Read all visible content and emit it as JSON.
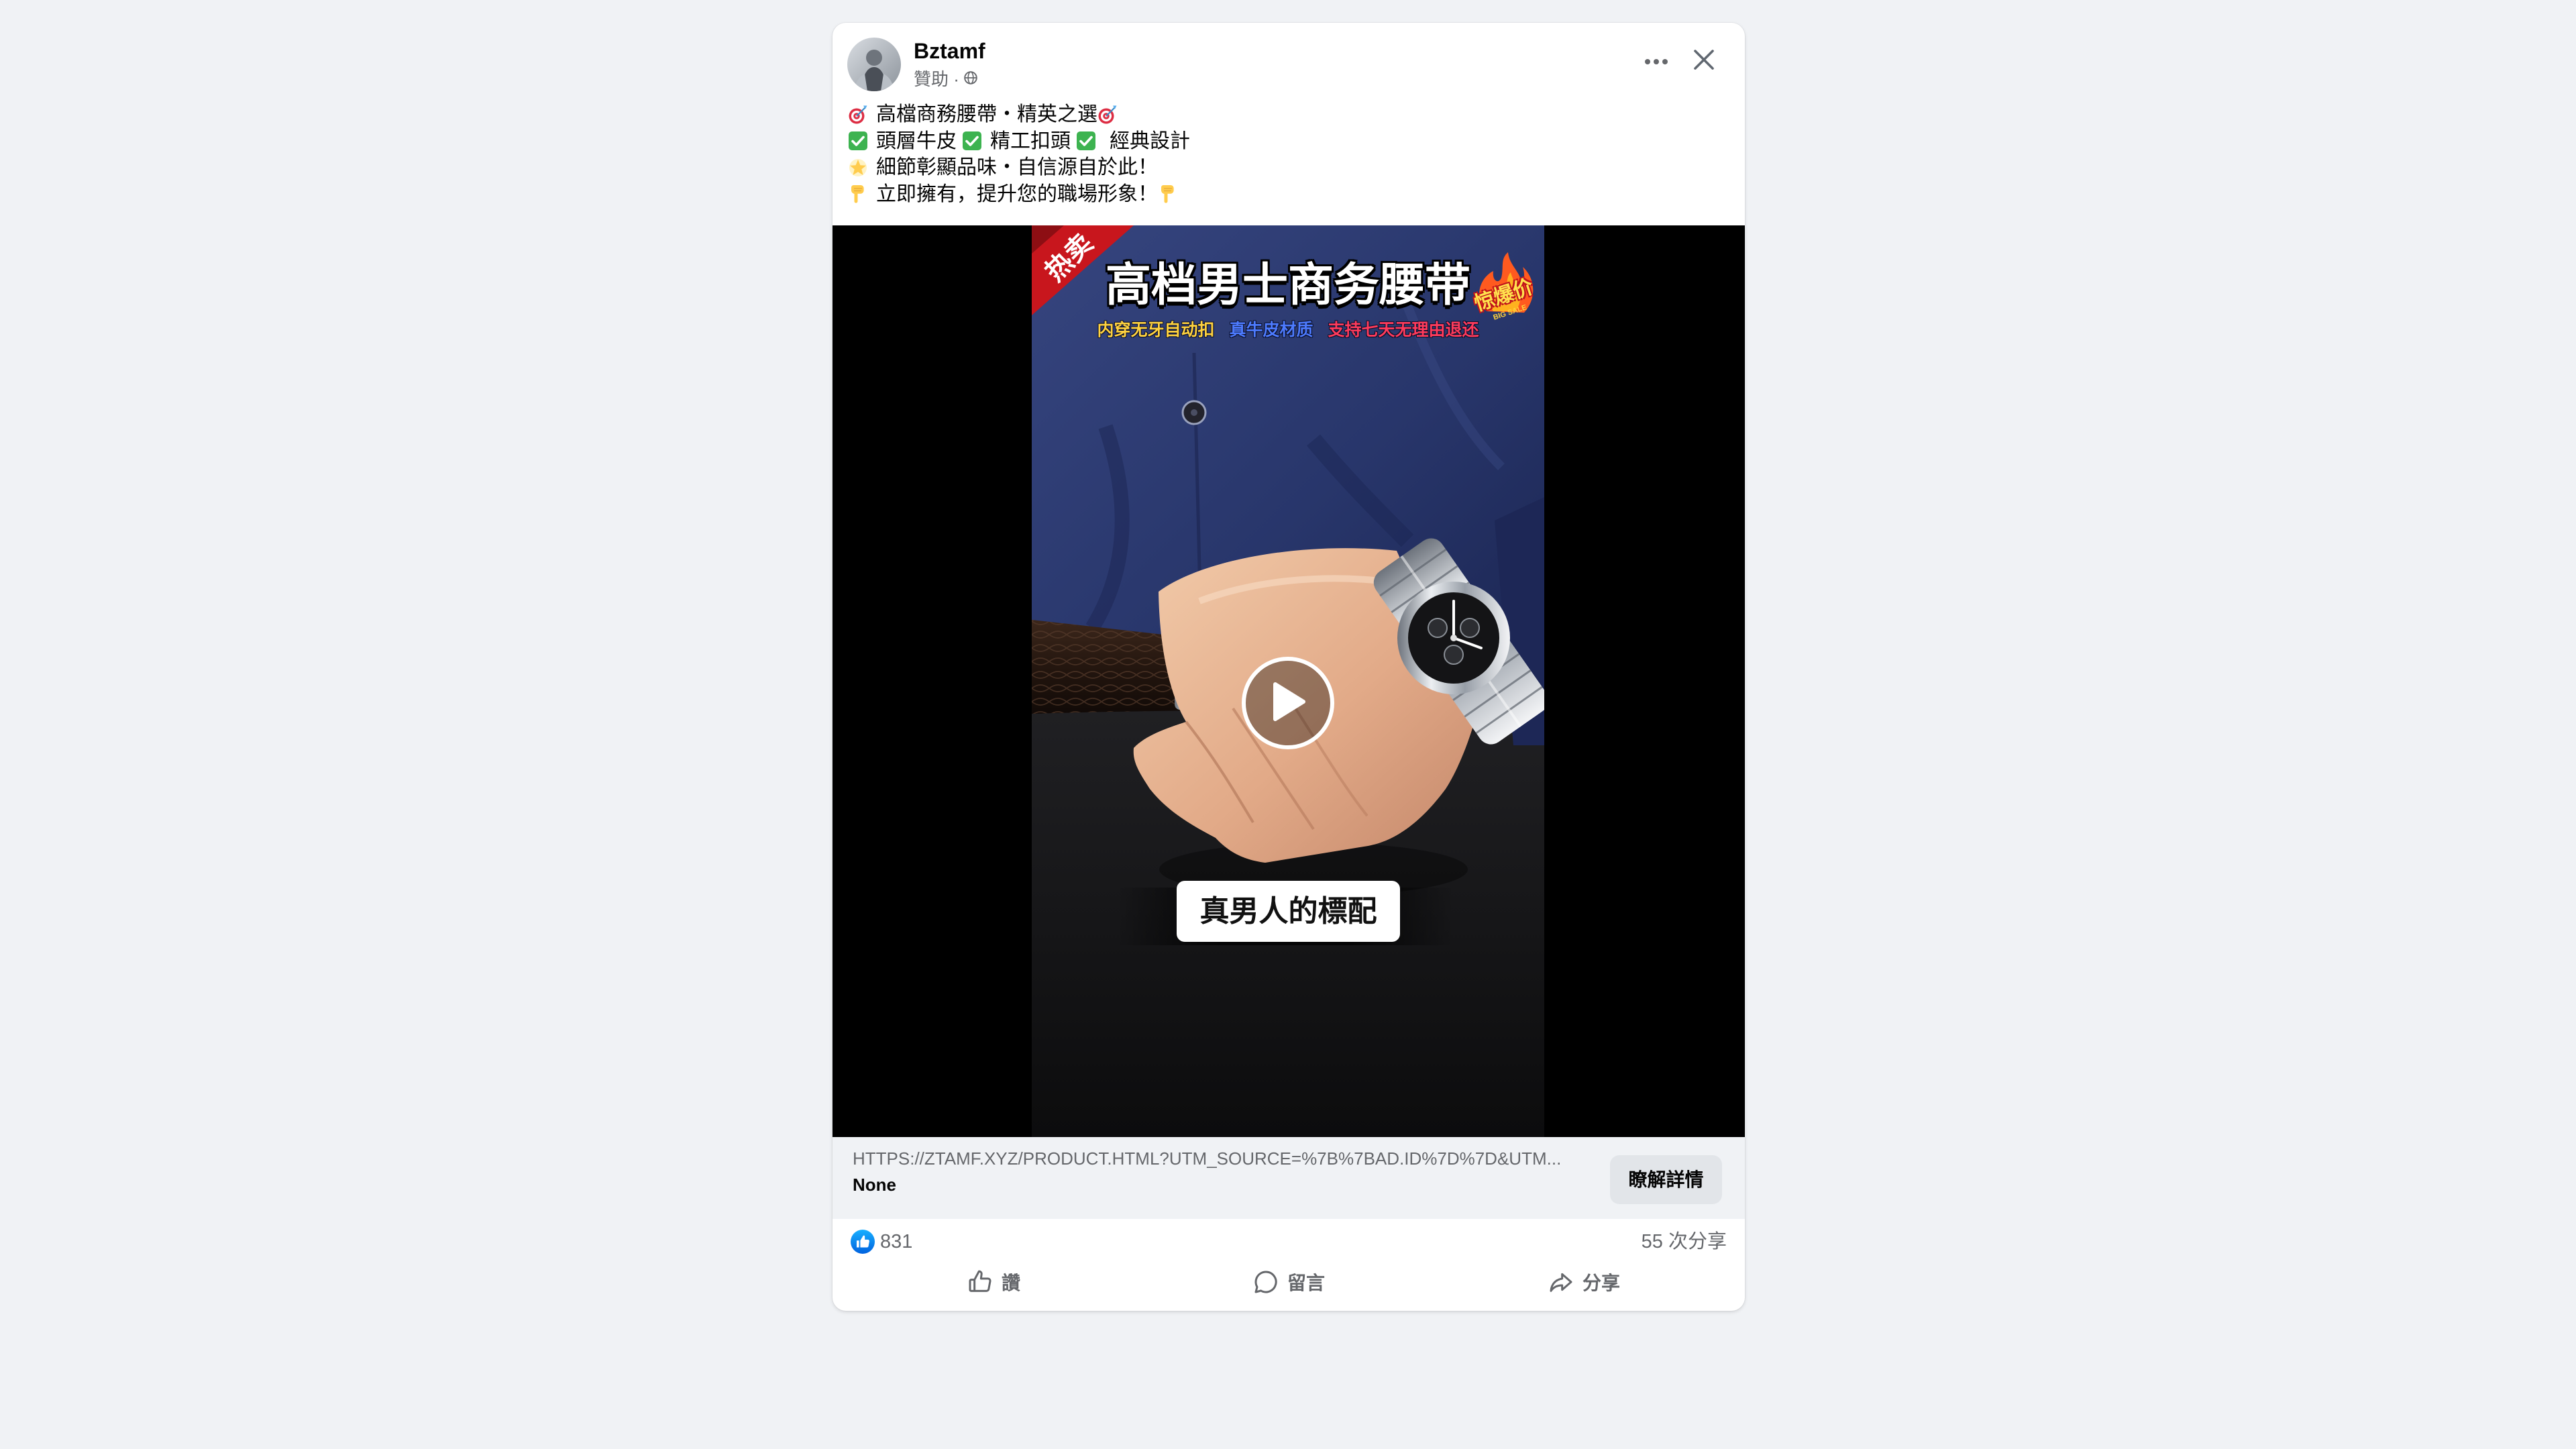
{
  "theme": {
    "background": "#f0f2f5",
    "card": "#ffffff",
    "accent": "#0866ff",
    "secondary_text": "#65676b"
  },
  "post": {
    "author": {
      "name": "Bztamf",
      "meta": "贊助 ·",
      "privacy_icon": "globe-icon",
      "avatar_icon": "avatar"
    },
    "header_icons": {
      "more": "more-horizontal-icon",
      "close": "close-icon"
    },
    "text_lines": [
      {
        "icon_start": "target-icon",
        "text": "高檔商務腰帶・精英之選",
        "icon_end": "target-icon"
      },
      {
        "items": [
          {
            "icon": "check-icon",
            "text": "頭層牛皮"
          },
          {
            "icon": "check-icon",
            "text": "精工扣頭"
          },
          {
            "icon": "check-icon",
            "text": "經典設計"
          }
        ]
      },
      {
        "icon_start": "star-icon",
        "text": "細節彰顯品味・自信源自於此！"
      },
      {
        "icon_start": "pointing-down-icon",
        "text": "立即擁有，提升您的職場形象！",
        "icon_end": "pointing-down-icon"
      }
    ],
    "video": {
      "ribbon": "热卖",
      "headline": "高档男士商务腰带",
      "badge": {
        "text": "惊爆价",
        "sub": "BIG SALE"
      },
      "features": [
        {
          "text": "内穿无牙自动扣",
          "color": "#ffd23f"
        },
        {
          "text": "真牛皮材质",
          "color": "#4d7bff"
        },
        {
          "text": "支持七天无理由退还",
          "color": "#ff3b5c"
        }
      ],
      "caption": "真男人的標配",
      "play_icon": "play-icon"
    },
    "link": {
      "url": "HTTPS://ZTAMF.XYZ/PRODUCT.HTML?UTM_SOURCE=%7B%7BAD.ID%7D%7D&UTM...",
      "title": "None",
      "cta": "瞭解詳情"
    },
    "stats": {
      "reaction_icon": "like-reaction-icon",
      "reactions": "831",
      "shares": "55 次分享"
    },
    "actions": [
      {
        "label": "讚",
        "icon": "thumbs-up-icon"
      },
      {
        "label": "留言",
        "icon": "comment-icon"
      },
      {
        "label": "分享",
        "icon": "share-icon"
      }
    ]
  }
}
